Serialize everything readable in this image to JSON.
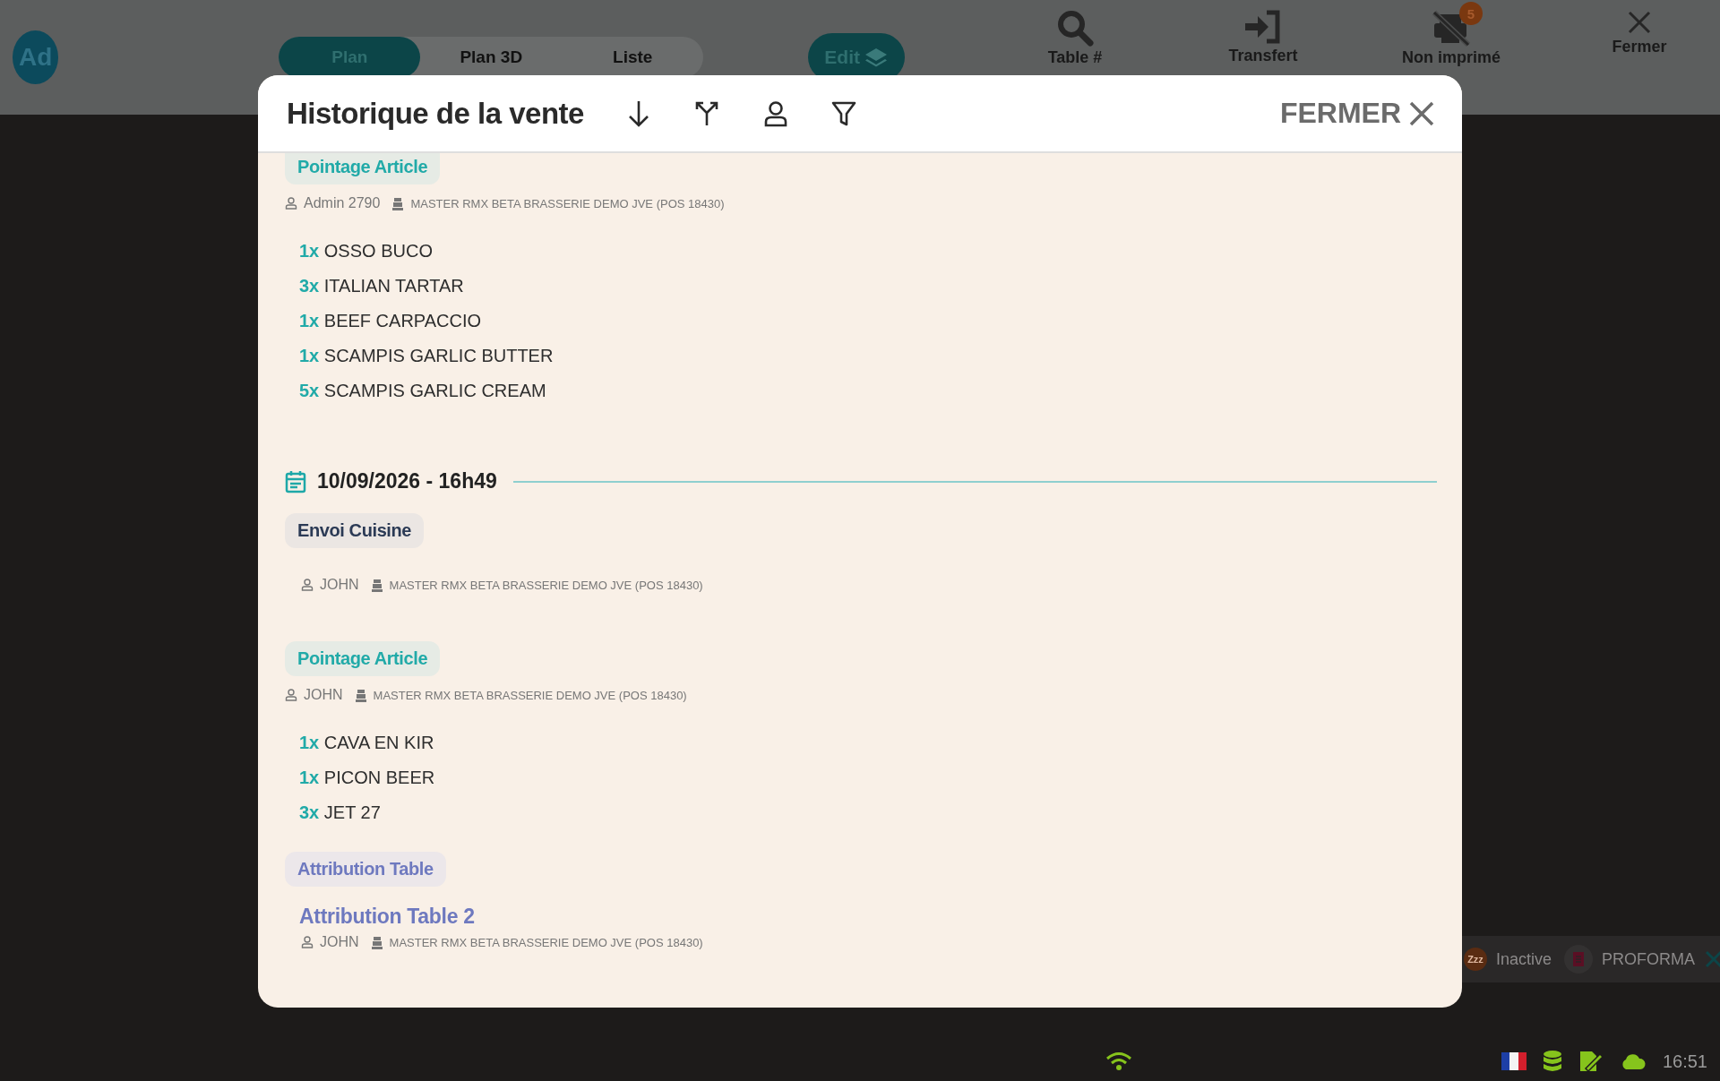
{
  "topbar": {
    "avatar": "Ad",
    "view_tabs": [
      {
        "label": "Plan",
        "selected": true
      },
      {
        "label": "Plan 3D",
        "selected": false
      },
      {
        "label": "Liste",
        "selected": false
      }
    ],
    "edit_button": "Edit",
    "actions": [
      {
        "kind": "search",
        "label": "Table #"
      },
      {
        "kind": "transfer",
        "label": "Transfert"
      },
      {
        "kind": "unprinted",
        "label": "Non imprimé",
        "badge": "5"
      },
      {
        "kind": "close",
        "label": "Fermer"
      }
    ]
  },
  "modal": {
    "title": "Historique de la vente",
    "close_label": "FERMER",
    "groups": [
      {
        "events": [
          {
            "kind": "pointage",
            "label": "Pointage Article",
            "user": "Admin 2790",
            "device": "MASTER RMX BETA BRASSERIE DEMO JVE (POS 18430)",
            "items": [
              {
                "qty": "1x",
                "name": "OSSO BUCO"
              },
              {
                "qty": "3x",
                "name": "ITALIAN TARTAR"
              },
              {
                "qty": "1x",
                "name": "BEEF CARPACCIO"
              },
              {
                "qty": "1x",
                "name": "SCAMPIS GARLIC BUTTER"
              },
              {
                "qty": "5x",
                "name": "SCAMPIS GARLIC CREAM"
              }
            ]
          }
        ]
      },
      {
        "date": "10/09/2026 - 16h49",
        "events": [
          {
            "kind": "envoi",
            "label": "Envoi Cuisine",
            "user": "JOHN",
            "device": "MASTER RMX BETA BRASSERIE DEMO JVE (POS 18430)"
          },
          {
            "kind": "pointage",
            "label": "Pointage Article",
            "user": "JOHN",
            "device": "MASTER RMX BETA BRASSERIE DEMO JVE (POS 18430)",
            "items": [
              {
                "qty": "1x",
                "name": "CAVA EN KIR"
              },
              {
                "qty": "1x",
                "name": "PICON BEER"
              },
              {
                "qty": "3x",
                "name": "JET 27"
              }
            ]
          },
          {
            "kind": "attribution",
            "label": "Attribution Table",
            "detail": "Attribution Table 2",
            "user": "JOHN",
            "device": "MASTER RMX BETA BRASSERIE DEMO JVE (POS 18430)"
          }
        ]
      }
    ]
  },
  "status_pill": {
    "state": "Inactive",
    "state_icon": "Zzz",
    "document": "PROFORMA"
  },
  "status_bar": {
    "time": "16:51"
  }
}
